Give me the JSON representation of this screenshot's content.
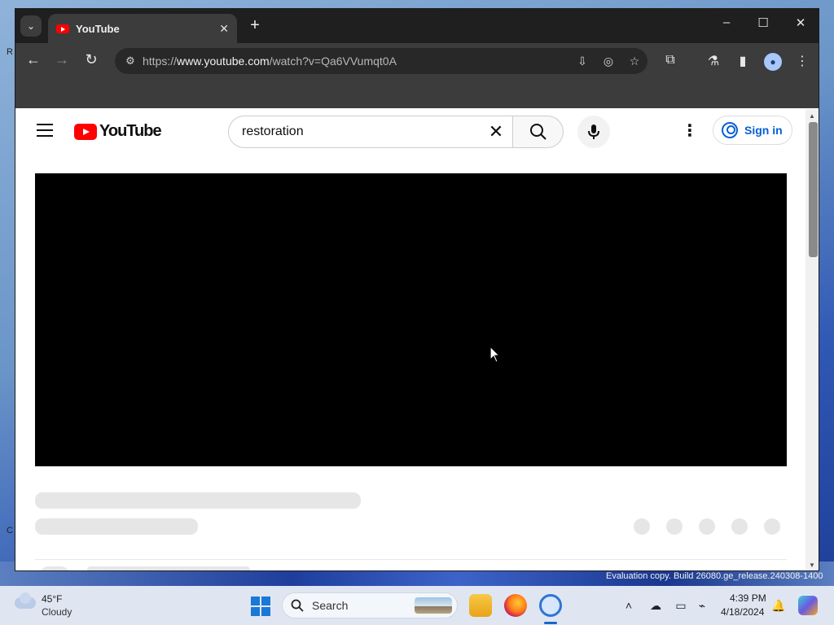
{
  "browser": {
    "tab_title": "YouTube",
    "new_tab": "+",
    "url_prefix": "https://",
    "url_host": "www.youtube.com",
    "url_path": "/watch?v=Qa6VVumqt0A"
  },
  "youtube": {
    "logo_text": "YouTube",
    "search_query": "restoration",
    "sign_in_label": "Sign in"
  },
  "watermark": "Evaluation copy. Build 26080.ge_release.240308-1400",
  "taskbar": {
    "weather_temp": "45°F",
    "weather_condition": "Cloudy",
    "search_label": "Search",
    "time": "4:39 PM",
    "date": "4/18/2024"
  },
  "colors": {
    "youtube_red": "#ff0000",
    "signin_blue": "#065fd4",
    "browser_dark": "#1f1f1f"
  }
}
